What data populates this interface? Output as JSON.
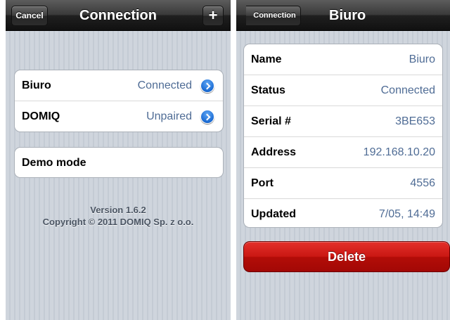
{
  "list_screen": {
    "title": "Connection",
    "cancel_label": "Cancel",
    "add_label": "+",
    "devices": [
      {
        "name": "Biuro",
        "status": "Connected"
      },
      {
        "name": "DOMIQ",
        "status": "Unpaired"
      }
    ],
    "demo_mode_label": "Demo mode",
    "version": "Version 1.6.2",
    "copyright": "Copyright © 2011 DOMIQ Sp. z o.o."
  },
  "detail_screen": {
    "title": "Biuro",
    "back_label": "Connection",
    "fields": [
      {
        "label": "Name",
        "value": "Biuro"
      },
      {
        "label": "Status",
        "value": "Connected"
      },
      {
        "label": "Serial #",
        "value": "3BE653"
      },
      {
        "label": "Address",
        "value": "192.168.10.20"
      },
      {
        "label": "Port",
        "value": "4556"
      },
      {
        "label": "Updated",
        "value": "7/05, 14:49"
      }
    ],
    "delete_label": "Delete"
  },
  "colors": {
    "value_text": "#4f6c95",
    "delete_button": "#c91712",
    "disclosure": "#1f6fd6"
  }
}
